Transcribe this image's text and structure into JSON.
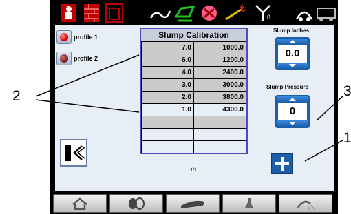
{
  "top_bar": {
    "icons": [
      "alarm-person-icon",
      "brick-grid-icon",
      "tank-icon",
      "chute-icon",
      "green-mode-icon",
      "no-water-icon",
      "spray-icon",
      "valve-icon",
      "operator-icon",
      "truck-icon"
    ]
  },
  "profiles": [
    {
      "label": "profile 1",
      "state": "active"
    },
    {
      "label": "profile 2",
      "state": "inactive"
    }
  ],
  "table": {
    "title": "Slump Calibration",
    "rows": [
      {
        "slump": "7.0",
        "pressure": "1000.0"
      },
      {
        "slump": "6.0",
        "pressure": "1200.0"
      },
      {
        "slump": "4.0",
        "pressure": "2400.0"
      },
      {
        "slump": "3.0",
        "pressure": "3000.0"
      },
      {
        "slump": "2.0",
        "pressure": "3800.0"
      },
      {
        "slump": "1.0",
        "pressure": "4300.0"
      },
      {
        "slump": "",
        "pressure": ""
      },
      {
        "slump": "",
        "pressure": ""
      },
      {
        "slump": "",
        "pressure": ""
      }
    ]
  },
  "slump_inches": {
    "label": "Slump Inches",
    "value": "0.0"
  },
  "slump_pressure": {
    "label": "Slump Pressure",
    "value": "0"
  },
  "page_indicator": "1/1",
  "bottom_nav": [
    "home-icon",
    "drum-icon",
    "chute-icon",
    "nozzle-icon",
    "spray-icon"
  ],
  "callouts": {
    "two": "2",
    "three": "3",
    "one": "1"
  },
  "colors": {
    "accent": "#1c5ea8",
    "frame": "#000000",
    "screen": "#e8eef6"
  }
}
